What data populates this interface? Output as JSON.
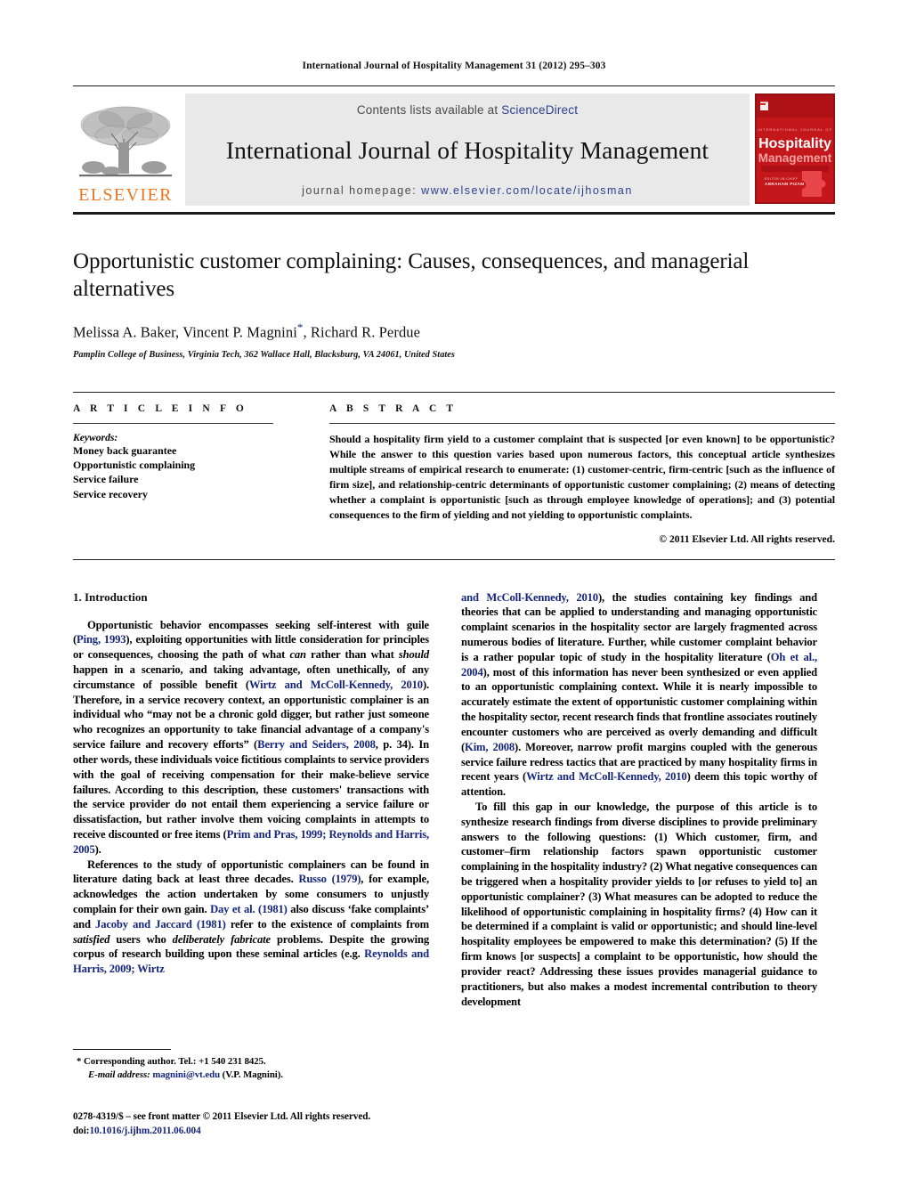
{
  "running_head": "International Journal of Hospitality Management 31 (2012) 295–303",
  "masthead": {
    "contents_prefix": "Contents lists available at ",
    "contents_link": "ScienceDirect",
    "journal_title": "International Journal of Hospitality Management",
    "homepage_prefix": "journal homepage: ",
    "homepage_url": "www.elsevier.com/locate/ijhosman",
    "publisher_wordmark": "ELSEVIER",
    "publisher_color": "#e87722",
    "link_color": "#2b3f8c",
    "cover": {
      "line1": "INTERNATIONAL JOURNAL OF",
      "line2": "Hospitality",
      "line3": "Management",
      "line4": "EDITOR-IN-CHIEF",
      "line5": "ABRAHAM PIZAM",
      "background_color": "#c21a1a"
    }
  },
  "article": {
    "title": "Opportunistic customer complaining: Causes, consequences, and managerial alternatives",
    "authors": "Melissa A. Baker, Vincent P. Magnini",
    "authors_tail": ", Richard R. Perdue",
    "corresponding_marker": "*",
    "affiliation": "Pamplin College of Business, Virginia Tech, 362 Wallace Hall, Blacksburg, VA 24061, United States"
  },
  "article_info": {
    "heading": "A R T I C L E   I N F O",
    "keywords_label": "Keywords:",
    "keywords": [
      "Money back guarantee",
      "Opportunistic complaining",
      "Service failure",
      "Service recovery"
    ]
  },
  "abstract": {
    "heading": "A B S T R A C T",
    "text": "Should a hospitality firm yield to a customer complaint that is suspected [or even known] to be opportunistic? While the answer to this question varies based upon numerous factors, this conceptual article synthesizes multiple streams of empirical research to enumerate: (1) customer-centric, firm-centric [such as the influence of firm size], and relationship-centric determinants of opportunistic customer complaining; (2) means of detecting whether a complaint is opportunistic [such as through employee knowledge of operations]; and (3) potential consequences to the firm of yielding and not yielding to opportunistic complaints.",
    "copyright": "© 2011 Elsevier Ltd. All rights reserved."
  },
  "body": {
    "section_number_title": "1. Introduction",
    "left_paragraphs": [
      {
        "id": "p1",
        "text": "Opportunistic behavior encompasses seeking self-interest with guile (Ping, 1993), exploiting opportunities with little consideration for principles or consequences, choosing the path of what can rather than what should happen in a scenario, and taking advantage, often unethically, of any circumstance of possible benefit (Wirtz and McColl-Kennedy, 2010). Therefore, in a service recovery context, an opportunistic complainer is an individual who \"may not be a chronic gold digger, but rather just someone who recognizes an opportunity to take financial advantage of a company's service failure and recovery efforts\" (Berry and Seiders, 2008, p. 34). In other words, these individuals voice fictitious complaints to service providers with the goal of receiving compensation for their make-believe service failures. According to this description, these customers' transactions with the service provider do not entail them experiencing a service failure or dissatisfaction, but rather involve them voicing complaints in attempts to receive discounted or free items (Prim and Pras, 1999; Reynolds and Harris, 2005)."
      },
      {
        "id": "p2",
        "text": "References to the study of opportunistic complainers can be found in literature dating back at least three decades. Russo (1979), for example, acknowledges the action undertaken by some consumers to unjustly complain for their own gain. Day et al. (1981) also discuss 'fake complaints' and Jacoby and Jaccard (1981) refer to the existence of complaints from satisfied users who deliberately fabricate problems. Despite the growing corpus of research building upon these seminal articles (e.g. Reynolds and Harris, 2009; Wirtz"
      }
    ],
    "right_paragraphs": [
      {
        "id": "p3",
        "text": "and McColl-Kennedy, 2010), the studies containing key findings and theories that can be applied to understanding and managing opportunistic complaint scenarios in the hospitality sector are largely fragmented across numerous bodies of literature. Further, while customer complaint behavior is a rather popular topic of study in the hospitality literature (Oh et al., 2004), most of this information has never been synthesized or even applied to an opportunistic complaining context. While it is nearly impossible to accurately estimate the extent of opportunistic customer complaining within the hospitality sector, recent research finds that frontline associates routinely encounter customers who are perceived as overly demanding and difficult (Kim, 2008). Moreover, narrow profit margins coupled with the generous service failure redress tactics that are practiced by many hospitality firms in recent years (Wirtz and McColl-Kennedy, 2010) deem this topic worthy of attention."
      },
      {
        "id": "p4",
        "text": "To fill this gap in our knowledge, the purpose of this article is to synthesize research findings from diverse disciplines to provide preliminary answers to the following questions: (1) Which customer, firm, and customer–firm relationship factors spawn opportunistic customer complaining in the hospitality industry? (2) What negative consequences can be triggered when a hospitality provider yields to [or refuses to yield to] an opportunistic complainer? (3) What measures can be adopted to reduce the likelihood of opportunistic complaining in hospitality firms? (4) How can it be determined if a complaint is valid or opportunistic; and should line-level hospitality employees be empowered to make this determination? (5) If the firm knows [or suspects] a complaint to be opportunistic, how should the provider react? Addressing these issues provides managerial guidance to practitioners, but also makes a modest incremental contribution to theory development"
      }
    ]
  },
  "footnote": {
    "corresponding": "* Corresponding author. Tel.: +1 540 231 8425.",
    "email_label": "E-mail address:",
    "email": "magnini@vt.edu",
    "email_suffix": " (V.P. Magnini).",
    "email_color": "#16257c"
  },
  "imprint": {
    "issn_line": "0278-4319/$ – see front matter © 2011 Elsevier Ltd. All rights reserved.",
    "doi_label": "doi:",
    "doi_value": "10.1016/j.ijhm.2011.06.004"
  }
}
